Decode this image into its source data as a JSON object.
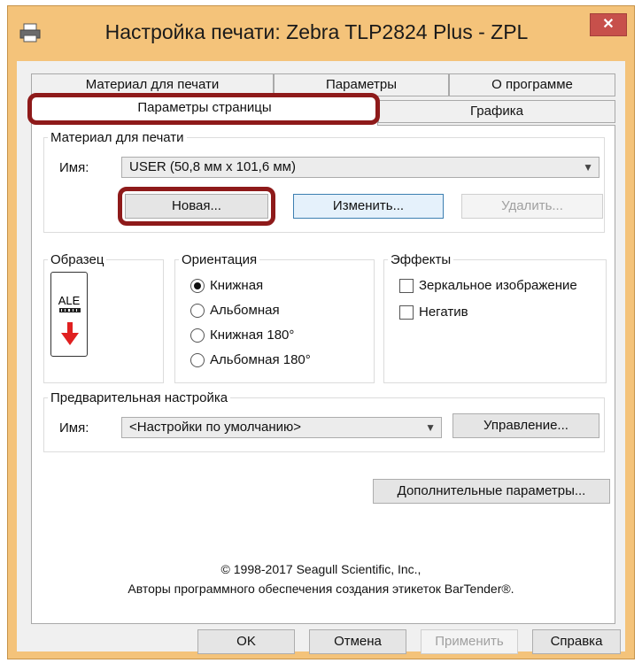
{
  "window": {
    "title": "Настройка печати: Zebra TLP2824 Plus - ZPL",
    "close_symbol": "✕"
  },
  "tabs": {
    "row_back": [
      "Материал для печати",
      "Параметры",
      "О программе"
    ],
    "row_front": [
      "Параметры страницы",
      "Графика"
    ],
    "active": "Параметры страницы"
  },
  "media": {
    "group_title": "Материал для печати",
    "name_label": "Имя:",
    "name_value": "USER (50,8 мм x 101,6 мм)",
    "new_button": "Новая...",
    "edit_button": "Изменить...",
    "delete_button": "Удалить..."
  },
  "sample": {
    "group_title": "Образец",
    "label_text": "ALE"
  },
  "orientation": {
    "group_title": "Ориентация",
    "options": [
      "Книжная",
      "Альбомная",
      "Книжная 180°",
      "Альбомная 180°"
    ],
    "selected": "Книжная"
  },
  "effects": {
    "group_title": "Эффекты",
    "mirror": "Зеркальное изображение",
    "negative": "Негатив",
    "mirror_checked": false,
    "negative_checked": false
  },
  "preset": {
    "group_title": "Предварительная настройка",
    "name_label": "Имя:",
    "name_value": "<Настройки по умолчанию>",
    "manage_button": "Управление..."
  },
  "advanced_button": "Дополнительные параметры...",
  "copyright": {
    "line1": "© 1998-2017 Seagull Scientific, Inc.,",
    "line2": "Авторы программного обеспечения создания этикеток BarTender®."
  },
  "footer": {
    "ok": "OK",
    "cancel": "Отмена",
    "apply": "Применить",
    "help": "Справка"
  },
  "colors": {
    "title_bar": "#f4c37a",
    "close_button": "#c7504b",
    "highlight": "#8e1a1a",
    "arrow_red": "#e02020"
  },
  "icons": {
    "window": "printer-icon",
    "close": "close-icon",
    "dropdown": "chevron-down-icon"
  }
}
